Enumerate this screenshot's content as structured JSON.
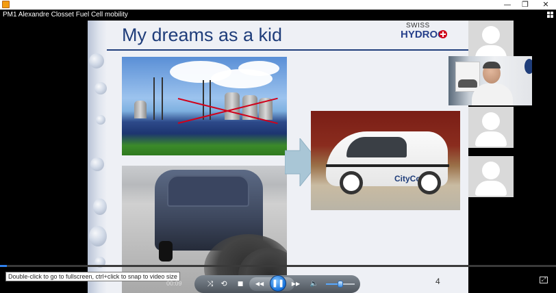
{
  "window": {
    "title": "PM1 Alexandre Closset Fuel Cell mobility",
    "minimize_label": "—",
    "restore_label": "❐",
    "close_label": "✕",
    "app_icon": "media-player-icon",
    "grid_icon": "grid-view-icon"
  },
  "slide": {
    "title": "My dreams as a kid",
    "logo_line1": "SWISS",
    "logo_line2": "HYDROG",
    "car_brand_text": "CityCom",
    "page_number": "4",
    "accent_color": "#1f3d7a"
  },
  "participants": {
    "avatar_icon": "user-avatar-icon",
    "tiles": [
      "participant-1",
      "participant-2",
      "participant-3"
    ],
    "speaker": "active-speaker-video"
  },
  "player": {
    "tooltip": "Double-click to go to fullscreen, ctrl+click to snap to video size",
    "current_time": "00:09",
    "progress_fraction": 0.012,
    "volume_fraction": 0.5,
    "buttons": {
      "shuffle": "⤨",
      "repeat": "⟲",
      "stop": "■",
      "rewind": "◀◀",
      "play_pause": "❚❚",
      "forward": "▶▶",
      "volume": "🔈",
      "fullscreen": "⤢"
    },
    "accent_color": "#2f80ed"
  }
}
